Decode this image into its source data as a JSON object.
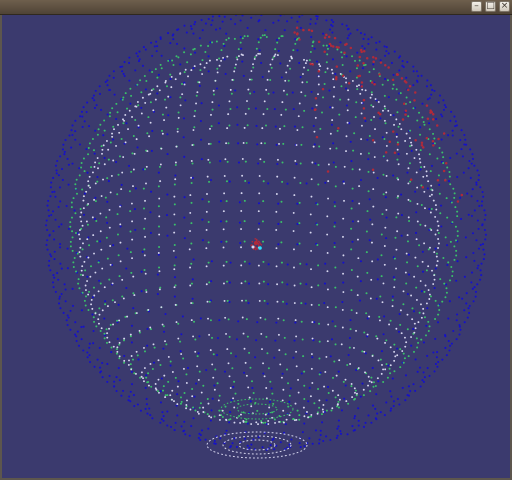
{
  "window": {
    "title": "",
    "buttons": {
      "minimize": "–",
      "maximize": "□",
      "close": "×"
    }
  },
  "scene": {
    "background": "#3b3a6e",
    "point_colors": {
      "white": "#d7d7ef",
      "blue": "#1511c9",
      "green": "#3bc06a",
      "red": "#b02a3a",
      "cyan": "#2de0ff"
    }
  },
  "icons": {
    "window_menu": "window-menu-icon",
    "minimize": "minimize-icon",
    "maximize": "maximize-icon",
    "close": "close-icon"
  }
}
